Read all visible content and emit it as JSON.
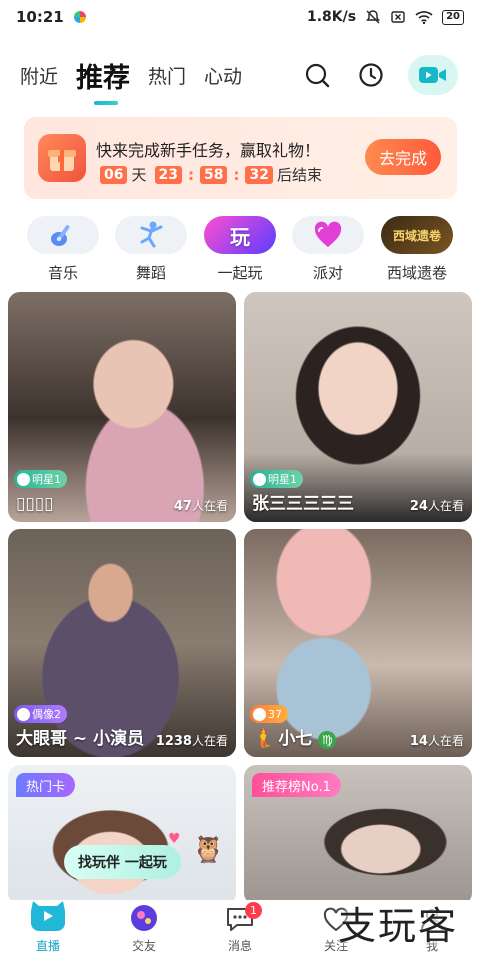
{
  "status_bar": {
    "time": "10:21",
    "network_speed": "1.8K/s",
    "battery": "20"
  },
  "top_nav": {
    "tabs": [
      "附近",
      "推荐",
      "热门",
      "心动"
    ],
    "active_tab": "推荐"
  },
  "banner": {
    "text": "快来完成新手任务，赢取礼物！",
    "days": "06",
    "day_unit": "天",
    "hours": "23",
    "minutes": "58",
    "seconds": "32",
    "suffix": "后结束",
    "button": "去完成"
  },
  "categories": [
    {
      "label": "音乐",
      "icon": "guitar-icon"
    },
    {
      "label": "舞蹈",
      "icon": "dancer-icon"
    },
    {
      "label": "一起玩",
      "icon": "play-together-icon",
      "icon_text": "玩"
    },
    {
      "label": "派对",
      "icon": "heart-icon"
    },
    {
      "label": "西域遗卷",
      "icon": "game-logo-icon",
      "icon_text": "西域遗卷"
    }
  ],
  "cards": [
    {
      "badge": "明星1",
      "name": "▯▯▯▯",
      "viewers": "47",
      "viewers_unit": "人在看"
    },
    {
      "badge": "明星1",
      "name": "张三三三三三",
      "viewers": "24",
      "viewers_unit": "人在看"
    },
    {
      "badge": "偶像2",
      "name": "大眼哥 ~ 小演员",
      "viewers": "1238",
      "viewers_unit": "人在看"
    },
    {
      "badge": "37",
      "name": "小七",
      "viewers": "14",
      "viewers_unit": "人在看"
    },
    {
      "tag": "热门卡",
      "overlay": "找玩伴 一起玩"
    },
    {
      "tag": "推荐榜No.1"
    }
  ],
  "bottom_nav": {
    "items": [
      "直播",
      "交友",
      "消息",
      "关注",
      "我"
    ],
    "active": "直播",
    "message_badge": "1"
  },
  "watermark": "支玩客",
  "colors": {
    "accent": "#1ab5d8",
    "banner_orange": "#ff6f4a",
    "notification_red": "#ff3b50"
  }
}
